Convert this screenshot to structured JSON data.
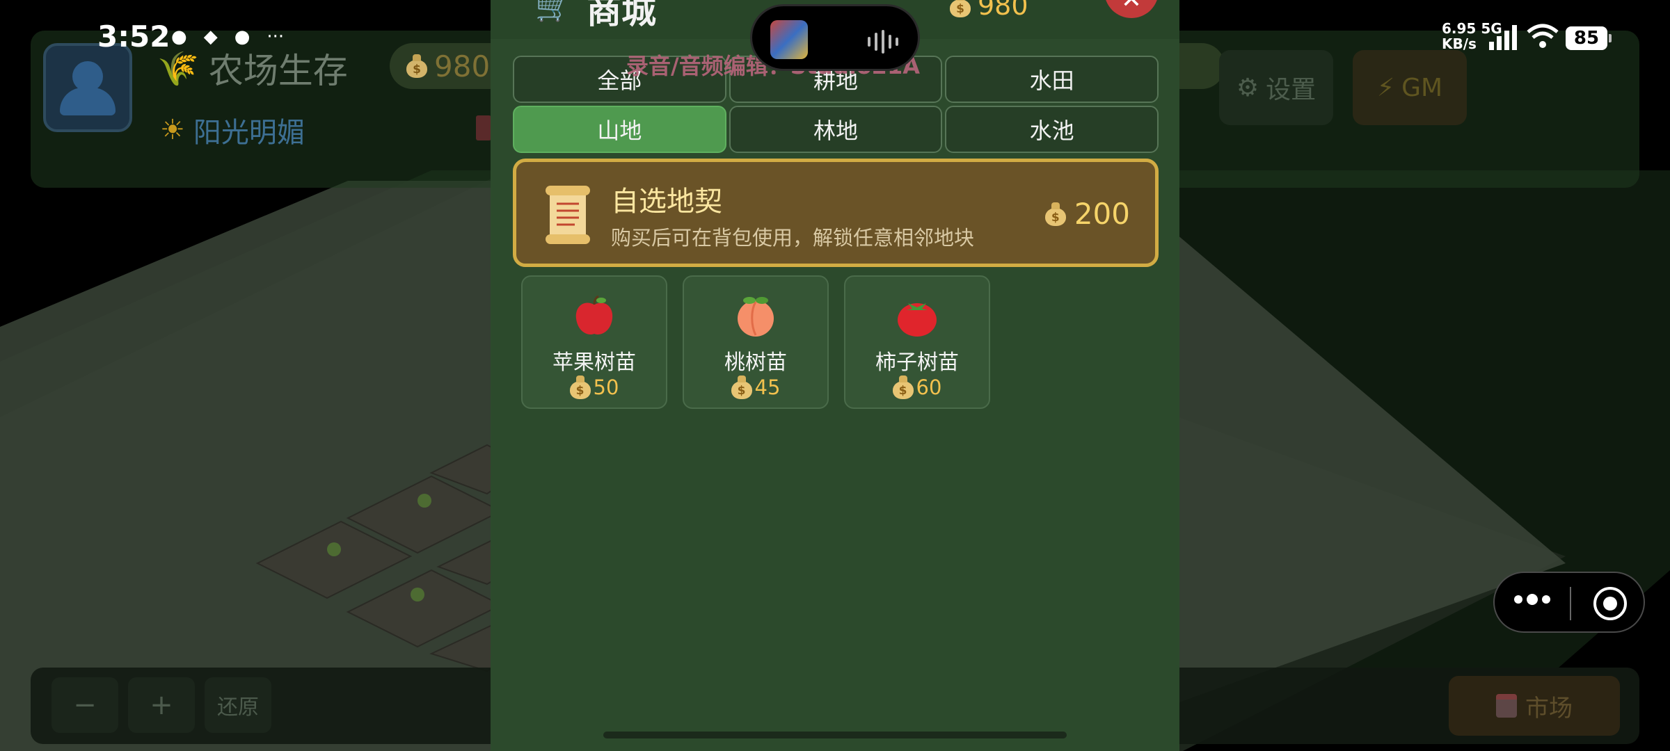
{
  "status_bar": {
    "time": "3:52",
    "net_speed_value": "6.95",
    "net_speed_unit": "KB/s",
    "network_type": "5G",
    "battery": "85"
  },
  "dynamic_island": {
    "recording_label": "录音/音频编辑：Studio21A"
  },
  "game_hud": {
    "title": "农场生存",
    "coins": "980",
    "weather": "阳光明媚",
    "settings_label": "设置",
    "gm_label": "GM",
    "zoom_out_label": "−",
    "zoom_in_label": "+",
    "reset_label": "还原",
    "market_label": "市场"
  },
  "shop": {
    "title": "商城",
    "coins": "980",
    "close_label": "✕",
    "tabs": [
      {
        "label": "全部",
        "active": false
      },
      {
        "label": "耕地",
        "active": false
      },
      {
        "label": "水田",
        "active": false
      },
      {
        "label": "山地",
        "active": true
      },
      {
        "label": "林地",
        "active": false
      },
      {
        "label": "水池",
        "active": false
      }
    ],
    "featured": {
      "name": "自选地契",
      "description": "购买后可在背包使用，解锁任意相邻地块",
      "price": "200",
      "icon": "scroll-icon"
    },
    "items": [
      {
        "name": "苹果树苗",
        "price": "50",
        "icon": "apple-icon",
        "color": "#d9262e"
      },
      {
        "name": "桃树苗",
        "price": "45",
        "icon": "peach-icon",
        "color": "#f58f69"
      },
      {
        "name": "柿子树苗",
        "price": "60",
        "icon": "tomato-icon",
        "color": "#e0252c"
      }
    ]
  },
  "colors": {
    "shop_bg": "#2c4a2c",
    "tab_active": "#4f9a4f",
    "deed_border": "#d2ac44",
    "coin_text": "#f2c14e",
    "close_button": "#c23a3a"
  }
}
